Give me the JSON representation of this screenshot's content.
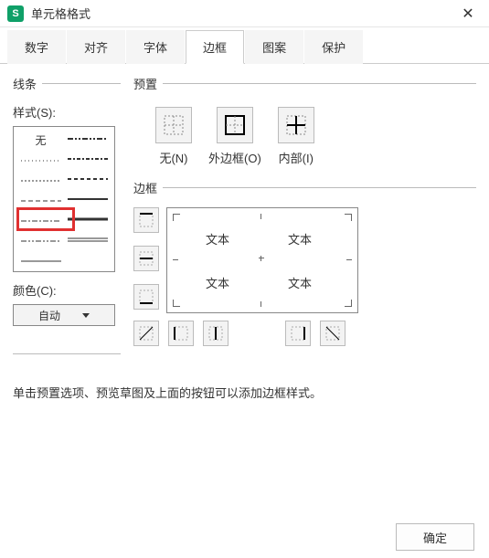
{
  "window": {
    "title": "单元格格式"
  },
  "tabs": [
    "数字",
    "对齐",
    "字体",
    "边框",
    "图案",
    "保护"
  ],
  "active_tab": 3,
  "left": {
    "line_group": "线条",
    "style_label": "样式(S):",
    "none_text": "无",
    "color_label": "颜色(C):",
    "color_value": "自动"
  },
  "right": {
    "preset_group": "预置",
    "presets": [
      {
        "label": "无(N)"
      },
      {
        "label": "外边框(O)"
      },
      {
        "label": "内部(I)"
      }
    ],
    "border_group": "边框",
    "preview_text": "文本"
  },
  "hint": "单击预置选项、预览草图及上面的按钮可以添加边框样式。",
  "buttons": {
    "ok": "确定"
  }
}
